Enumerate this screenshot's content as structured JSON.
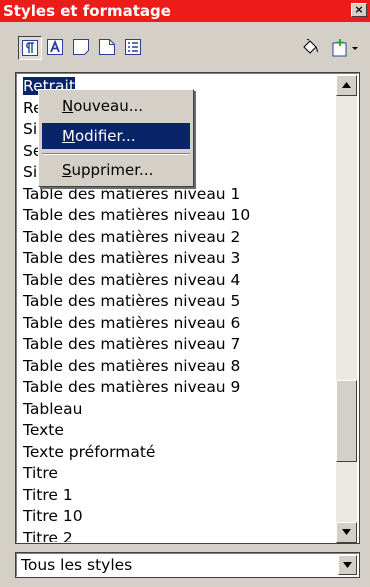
{
  "window": {
    "title": "Styles et formatage",
    "close_glyph": "×"
  },
  "toolbar": {
    "buttons": [
      {
        "name": "paragraph-styles-icon",
        "pressed": true
      },
      {
        "name": "character-styles-icon",
        "pressed": false
      },
      {
        "name": "frame-styles-icon",
        "pressed": false
      },
      {
        "name": "page-styles-icon",
        "pressed": false
      },
      {
        "name": "list-styles-icon",
        "pressed": false
      },
      {
        "name": "fill-format-mode-icon",
        "pressed": false
      },
      {
        "name": "new-style-from-selection-icon",
        "pressed": false
      }
    ]
  },
  "style_list": {
    "items": [
      {
        "label": "Retrait",
        "state": "selected-partly-hidden"
      },
      {
        "label": "Retrait négatif",
        "state": "partly-hidden"
      },
      {
        "label": "Si",
        "state": "partly-hidden"
      },
      {
        "label": "Se",
        "state": "partly-hidden"
      },
      {
        "label": "Si",
        "state": "partly-hidden"
      },
      {
        "label": "Table des matières niveau 1"
      },
      {
        "label": "Table des matières niveau 10"
      },
      {
        "label": "Table des matières niveau 2"
      },
      {
        "label": "Table des matières niveau 3"
      },
      {
        "label": "Table des matières niveau 4"
      },
      {
        "label": "Table des matières niveau 5"
      },
      {
        "label": "Table des matières niveau 6"
      },
      {
        "label": "Table des matières niveau 7"
      },
      {
        "label": "Table des matières niveau 8"
      },
      {
        "label": "Table des matières niveau 9"
      },
      {
        "label": "Tableau"
      },
      {
        "label": "Texte"
      },
      {
        "label": "Texte préformaté"
      },
      {
        "label": "Titre"
      },
      {
        "label": "Titre 1"
      },
      {
        "label": "Titre 10"
      },
      {
        "label": "Titre 2"
      }
    ]
  },
  "context_menu": {
    "new": {
      "u": "N",
      "rest": "ouveau..."
    },
    "modify": {
      "u": "M",
      "rest": "odifier..."
    },
    "delete": {
      "u": "S",
      "rest": "upprimer..."
    },
    "highlighted": "modify"
  },
  "filter": {
    "value": "Tous les styles"
  },
  "colors": {
    "title_bar": "#ee1b1b",
    "selection": "#0a246a",
    "face": "#d4d0c8"
  }
}
